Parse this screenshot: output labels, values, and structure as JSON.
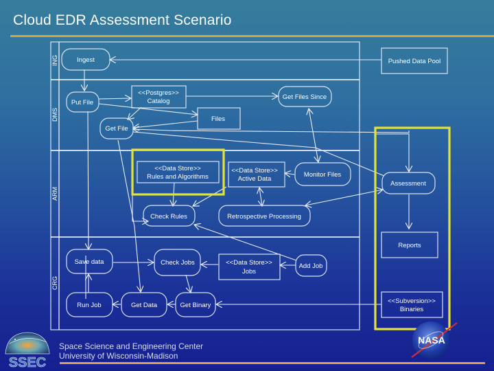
{
  "slide": {
    "title": "Cloud EDR Assessment Scenario",
    "footer": {
      "line1": "Space Science and Engineering Center",
      "line2": "University of Wisconsin-Madison"
    },
    "logos": {
      "left": "SSEC",
      "right": "NASA"
    },
    "colors": {
      "title_rule": "#d8a33c",
      "footer_rule": "#e09a5a",
      "highlight": "#e3e23a"
    }
  },
  "diagram": {
    "lanes": [
      {
        "id": "ING",
        "label": "ING"
      },
      {
        "id": "DMS",
        "label": "DMS"
      },
      {
        "id": "ARM",
        "label": "ARM"
      },
      {
        "id": "CRG",
        "label": "CRG"
      }
    ],
    "nodes": {
      "ingest": {
        "label": "Ingest",
        "kind": "activity",
        "lane": "ING"
      },
      "pushed_data_pool": {
        "label": "Pushed Data Pool",
        "kind": "object"
      },
      "put_file": {
        "label": "Put File",
        "kind": "activity",
        "lane": "DMS"
      },
      "postgres_catalog": {
        "stereotype": "<<Postgres>>",
        "label": "Catalog",
        "kind": "object",
        "lane": "DMS"
      },
      "get_files_since": {
        "label": "Get Files Since",
        "kind": "activity",
        "lane": "DMS"
      },
      "files": {
        "label": "Files",
        "kind": "object",
        "lane": "DMS"
      },
      "get_file": {
        "label": "Get File",
        "kind": "activity",
        "lane": "DMS"
      },
      "rules_algorithms": {
        "stereotype": "<<Data Store>>",
        "label": "Rules and Algorithms",
        "kind": "datastore",
        "lane": "ARM"
      },
      "active_data": {
        "stereotype": "<<Data Store>>",
        "label": "Active Data",
        "kind": "datastore",
        "lane": "ARM"
      },
      "monitor_files": {
        "label": "Monitor Files",
        "kind": "activity",
        "lane": "ARM"
      },
      "check_rules": {
        "label": "Check Rules",
        "kind": "activity",
        "lane": "ARM"
      },
      "retrospective_processing": {
        "label": "Retrospective Processing",
        "kind": "activity",
        "lane": "ARM"
      },
      "assessment": {
        "label": "Assessment",
        "kind": "activity"
      },
      "reports": {
        "label": "Reports",
        "kind": "object"
      },
      "save_data": {
        "label": "Save data",
        "kind": "activity",
        "lane": "CRG"
      },
      "check_jobs": {
        "label": "Check Jobs",
        "kind": "activity",
        "lane": "CRG"
      },
      "jobs": {
        "stereotype": "<<Data Store>>",
        "label": "Jobs",
        "kind": "datastore",
        "lane": "CRG"
      },
      "add_job": {
        "label": "Add Job",
        "kind": "activity",
        "lane": "CRG"
      },
      "run_job": {
        "label": "Run Job",
        "kind": "activity",
        "lane": "CRG"
      },
      "get_data": {
        "label": "Get Data",
        "kind": "activity",
        "lane": "CRG"
      },
      "get_binary": {
        "label": "Get Binary",
        "kind": "activity",
        "lane": "CRG"
      },
      "binaries": {
        "stereotype": "<<Subversion>>",
        "label": "Binaries",
        "kind": "object"
      }
    },
    "edges": [
      {
        "from": "pushed_data_pool",
        "to": "ingest"
      },
      {
        "from": "ingest",
        "to": "put_file"
      },
      {
        "from": "put_file",
        "to": "postgres_catalog"
      },
      {
        "from": "put_file",
        "to": "files"
      },
      {
        "from": "postgres_catalog",
        "to": "get_files_since"
      },
      {
        "from": "postgres_catalog",
        "to": "get_file"
      },
      {
        "from": "files",
        "to": "get_file"
      },
      {
        "from": "assessment",
        "to": "get_file"
      },
      {
        "from": "get_files_since",
        "to": "monitor_files",
        "bidirectional": true
      },
      {
        "from": "monitor_files",
        "to": "active_data"
      },
      {
        "from": "rules_algorithms",
        "to": "check_rules"
      },
      {
        "from": "active_data",
        "to": "check_rules"
      },
      {
        "from": "active_data",
        "to": "retrospective_processing",
        "bidirectional": true
      },
      {
        "from": "assessment",
        "to": "retrospective_processing",
        "bidirectional": true
      },
      {
        "from": "assessment",
        "to": "check_rules"
      },
      {
        "from": "get_data",
        "to": "check_rules"
      },
      {
        "from": "get_file",
        "to": "get_data"
      },
      {
        "from": "save_data",
        "to": "put_file"
      },
      {
        "from": "pushed_data_pool",
        "to": "assessment"
      },
      {
        "from": "assessment",
        "to": "reports"
      },
      {
        "from": "retrospective_processing",
        "to": "add_job"
      },
      {
        "from": "add_job",
        "to": "jobs"
      },
      {
        "from": "jobs",
        "to": "check_jobs"
      },
      {
        "from": "save_data",
        "to": "check_jobs"
      },
      {
        "from": "check_jobs",
        "to": "get_binary"
      },
      {
        "from": "get_binary",
        "to": "get_data"
      },
      {
        "from": "get_data",
        "to": "run_job"
      },
      {
        "from": "run_job",
        "to": "save_data"
      },
      {
        "from": "binaries",
        "to": "get_binary"
      }
    ],
    "highlights": [
      "rules_algorithms",
      "assessment_column"
    ]
  }
}
